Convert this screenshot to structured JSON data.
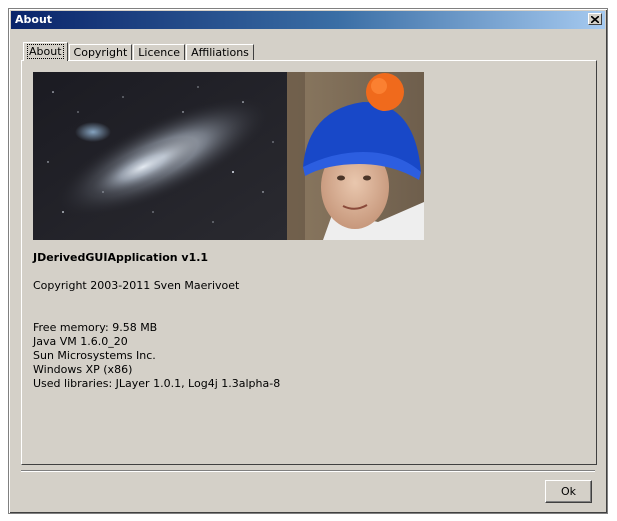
{
  "window": {
    "title": "About",
    "close_symbol": "✕"
  },
  "tabs": [
    {
      "label": "About",
      "active": true
    },
    {
      "label": "Copyright",
      "active": false
    },
    {
      "label": "Licence",
      "active": false
    },
    {
      "label": "Affiliations",
      "active": false
    }
  ],
  "about": {
    "photo_icon": "galaxy-and-portrait-image",
    "app_name": "JDerivedGUIApplication v1.1",
    "copyright": "Copyright 2003-2011 Sven Maerivoet",
    "free_memory": "Free memory: 9.58 MB",
    "java_vm": "Java VM 1.6.0_20",
    "vendor": "Sun Microsystems Inc.",
    "os": "Windows XP (x86)",
    "libraries": "Used libraries: JLayer 1.0.1, Log4j 1.3alpha-8"
  },
  "buttons": {
    "ok_label": "Ok"
  },
  "colors": {
    "titlebar_start": "#0a246a",
    "titlebar_end": "#a6caf0",
    "dialog_bg": "#d4d0c8"
  }
}
